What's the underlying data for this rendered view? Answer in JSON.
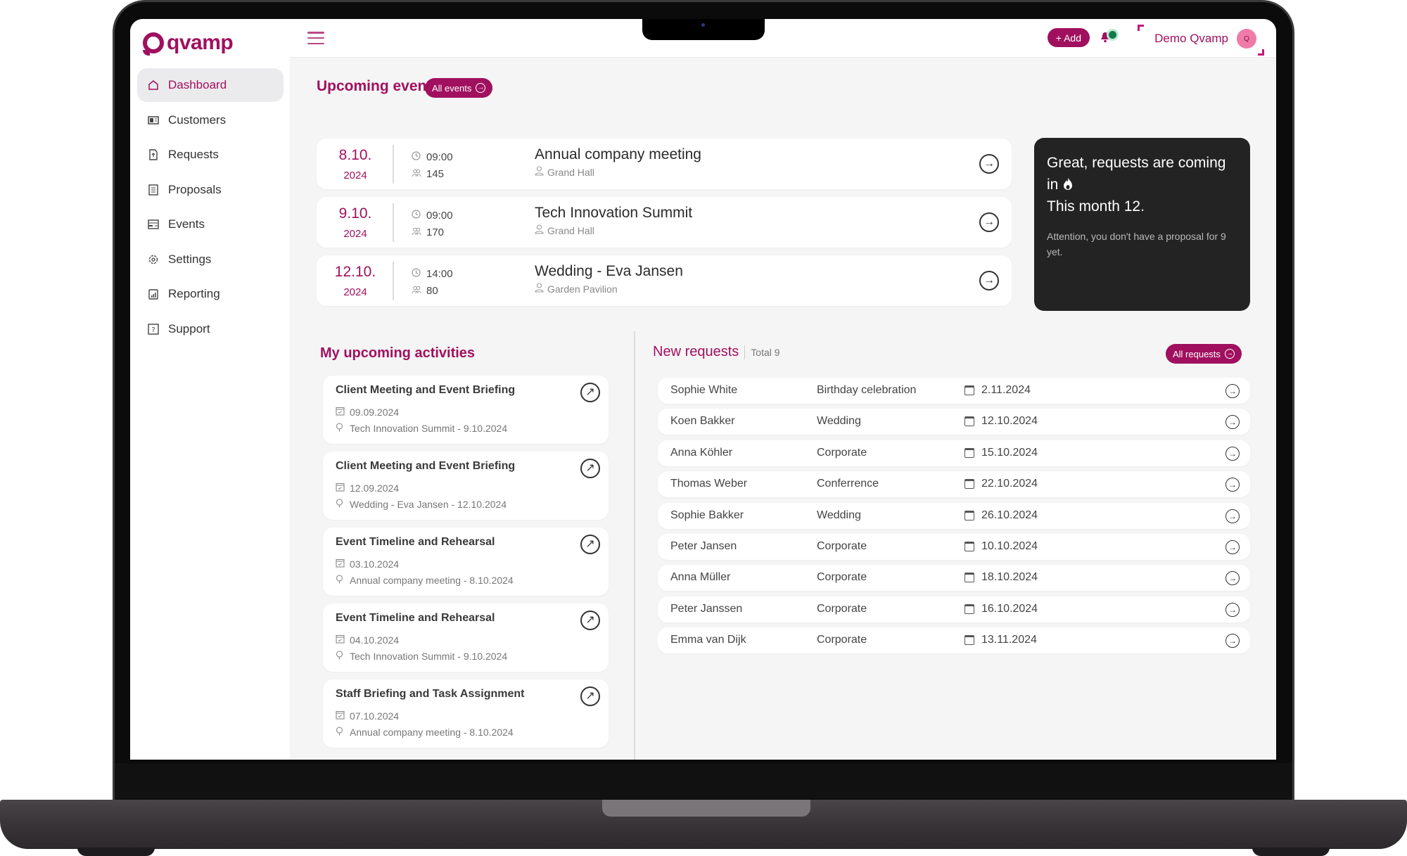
{
  "app": {
    "name": "qvamp"
  },
  "sidebar": {
    "items": [
      {
        "label": "Dashboard",
        "icon": "home-icon",
        "active": true
      },
      {
        "label": "Customers",
        "icon": "id-card-icon",
        "active": false
      },
      {
        "label": "Requests",
        "icon": "file-upload-icon",
        "active": false
      },
      {
        "label": "Proposals",
        "icon": "document-list-icon",
        "active": false
      },
      {
        "label": "Events",
        "icon": "calendar-card-icon",
        "active": false
      },
      {
        "label": "Settings",
        "icon": "gear-icon",
        "active": false
      },
      {
        "label": "Reporting",
        "icon": "report-chart-icon",
        "active": false
      },
      {
        "label": "Support",
        "icon": "help-icon",
        "active": false
      }
    ]
  },
  "topbar": {
    "add_label": "+ Add",
    "user_name": "Demo Qvamp",
    "avatar_initial": "Q",
    "notification_indicator": true
  },
  "upcoming_events": {
    "title": "Upcoming events",
    "all_button": "All events",
    "items": [
      {
        "day": "8.10.",
        "year": "2024",
        "time": "09:00",
        "guests": "145",
        "name": "Annual company meeting",
        "location": "Grand Hall"
      },
      {
        "day": "9.10.",
        "year": "2024",
        "time": "09:00",
        "guests": "170",
        "name": "Tech Innovation Summit",
        "location": "Grand Hall"
      },
      {
        "day": "12.10.",
        "year": "2024",
        "time": "14:00",
        "guests": "80",
        "name": "Wedding - Eva Jansen",
        "location": "Garden Pavilion"
      }
    ]
  },
  "promo": {
    "headline_1": "Great, requests are coming in",
    "headline_icon": "fire-icon",
    "headline_2": "This month 12.",
    "note": "Attention, you don't have a proposal for 9 yet."
  },
  "activities": {
    "title": "My upcoming activities",
    "items": [
      {
        "title": "Client Meeting and Event Briefing",
        "date": "09.09.2024",
        "event": "Tech Innovation Summit - 9.10.2024"
      },
      {
        "title": "Client Meeting and Event Briefing",
        "date": "12.09.2024",
        "event": "Wedding - Eva Jansen - 12.10.2024"
      },
      {
        "title": "Event Timeline and Rehearsal",
        "date": "03.10.2024",
        "event": "Annual company meeting - 8.10.2024"
      },
      {
        "title": "Event Timeline and Rehearsal",
        "date": "04.10.2024",
        "event": "Tech Innovation Summit - 9.10.2024"
      },
      {
        "title": "Staff Briefing and Task Assignment",
        "date": "07.10.2024",
        "event": "Annual company meeting - 8.10.2024"
      }
    ]
  },
  "requests": {
    "title": "New requests",
    "total_label": "Total 9",
    "all_button": "All requests",
    "rows": [
      {
        "name": "Sophie White",
        "type": "Birthday celebration",
        "date": "2.11.2024"
      },
      {
        "name": "Koen Bakker",
        "type": "Wedding",
        "date": "12.10.2024"
      },
      {
        "name": "Anna Köhler",
        "type": "Corporate",
        "date": "15.10.2024"
      },
      {
        "name": "Thomas Weber",
        "type": "Conferrence",
        "date": "22.10.2024"
      },
      {
        "name": "Sophie Bakker",
        "type": "Wedding",
        "date": "26.10.2024"
      },
      {
        "name": "Peter Jansen",
        "type": "Corporate",
        "date": "10.10.2024"
      },
      {
        "name": "Anna Müller",
        "type": "Corporate",
        "date": "18.10.2024"
      },
      {
        "name": "Peter Janssen",
        "type": "Corporate",
        "date": "16.10.2024"
      },
      {
        "name": "Emma van Dijk",
        "type": "Corporate",
        "date": "13.11.2024"
      }
    ]
  },
  "colors": {
    "brand": "#a0105f",
    "promo_bg": "#232323",
    "page_bg": "#f5f5f5",
    "notification_dot": "#107a4a",
    "avatar_bg": "#f07ba8"
  }
}
